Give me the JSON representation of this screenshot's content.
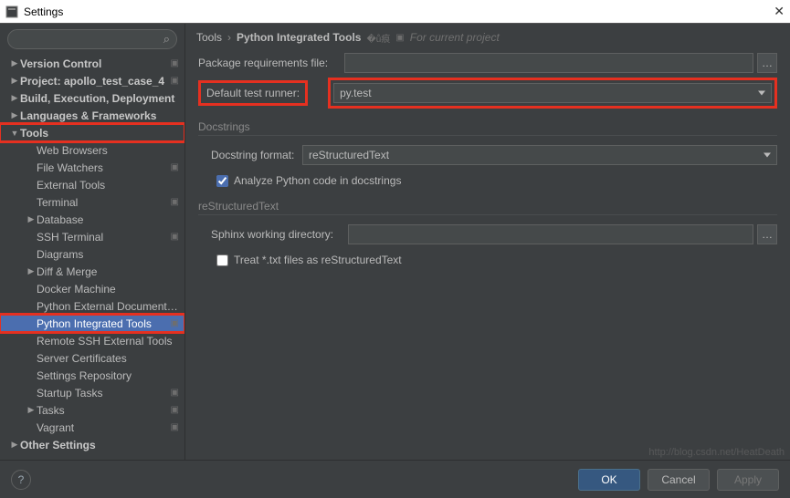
{
  "window": {
    "title": "Settings"
  },
  "sidebar": {
    "search_placeholder": "",
    "items": [
      {
        "label": "Version Control",
        "depth": 0,
        "arrow": "▶",
        "bold": true,
        "badge": true
      },
      {
        "label": "Project: apollo_test_case_4",
        "depth": 0,
        "arrow": "▶",
        "bold": true,
        "badge": true
      },
      {
        "label": "Build, Execution, Deployment",
        "depth": 0,
        "arrow": "▶",
        "bold": true
      },
      {
        "label": "Languages & Frameworks",
        "depth": 0,
        "arrow": "▶",
        "bold": true
      },
      {
        "label": "Tools",
        "depth": 0,
        "arrow": "▼",
        "bold": true,
        "hl": true
      },
      {
        "label": "Web Browsers",
        "depth": 1
      },
      {
        "label": "File Watchers",
        "depth": 1,
        "badge": true
      },
      {
        "label": "External Tools",
        "depth": 1
      },
      {
        "label": "Terminal",
        "depth": 1,
        "badge": true
      },
      {
        "label": "Database",
        "depth": 1,
        "arrow": "▶"
      },
      {
        "label": "SSH Terminal",
        "depth": 1,
        "badge": true
      },
      {
        "label": "Diagrams",
        "depth": 1
      },
      {
        "label": "Diff & Merge",
        "depth": 1,
        "arrow": "▶"
      },
      {
        "label": "Docker Machine",
        "depth": 1
      },
      {
        "label": "Python External Documentation",
        "depth": 1
      },
      {
        "label": "Python Integrated Tools",
        "depth": 1,
        "badge": true,
        "sel": true,
        "hl": true
      },
      {
        "label": "Remote SSH External Tools",
        "depth": 1
      },
      {
        "label": "Server Certificates",
        "depth": 1
      },
      {
        "label": "Settings Repository",
        "depth": 1
      },
      {
        "label": "Startup Tasks",
        "depth": 1,
        "badge": true
      },
      {
        "label": "Tasks",
        "depth": 1,
        "arrow": "▶",
        "badge": true
      },
      {
        "label": "Vagrant",
        "depth": 1,
        "badge": true
      },
      {
        "label": "Other Settings",
        "depth": 0,
        "arrow": "▶",
        "bold": true
      }
    ]
  },
  "crumbs": {
    "root": "Tools",
    "current": "Python Integrated Tools",
    "scope": "For current project"
  },
  "form": {
    "pkg_label": "Package requirements file:",
    "pkg_value": "",
    "runner_label": "Default test runner:",
    "runner_value": "py.test",
    "doc_section": "Docstrings",
    "docfmt_label": "Docstring format:",
    "docfmt_value": "reStructuredText",
    "analyze_label": "Analyze Python code in docstrings",
    "rst_section": "reStructuredText",
    "sphinx_label": "Sphinx working directory:",
    "sphinx_value": "",
    "treat_label": "Treat *.txt files as reStructuredText"
  },
  "footer": {
    "ok": "OK",
    "cancel": "Cancel",
    "apply": "Apply"
  },
  "watermark": "http://blog.csdn.net/HeatDeath"
}
